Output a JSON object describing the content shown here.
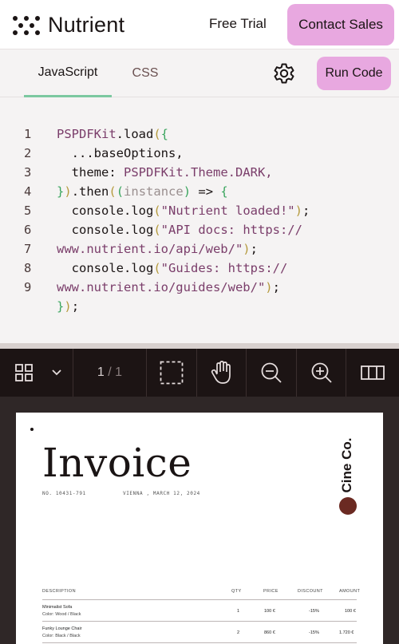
{
  "nav": {
    "brand": "Nutrient",
    "free_trial": "Free Trial",
    "contact_sales": "Contact Sales"
  },
  "editor": {
    "tabs": [
      {
        "label": "JavaScript",
        "active": true
      },
      {
        "label": "CSS",
        "active": false
      }
    ],
    "settings_icon": "gear-icon",
    "run_label": "Run Code",
    "accent": "#e8a8e0",
    "active_tab_color": "#7cc8a0",
    "lines": [
      {
        "n": "1",
        "parts": [
          [
            "PSPDFKit",
            "obj"
          ],
          [
            ".load",
            ""
          ],
          [
            "(",
            "par"
          ],
          [
            "{",
            "brk"
          ]
        ]
      },
      {
        "n": "2",
        "parts": [
          [
            "  ...baseOptions,",
            ""
          ]
        ]
      },
      {
        "n": "3",
        "parts": [
          [
            "  theme: ",
            ""
          ],
          [
            "PSPDFKit",
            "obj"
          ],
          [
            ".Theme.DARK,",
            "obj"
          ]
        ]
      },
      {
        "n": "4",
        "parts": [
          [
            "}",
            "brk"
          ],
          [
            ")",
            "par"
          ],
          [
            ".then",
            ""
          ],
          [
            "(",
            "par"
          ],
          [
            "(",
            "brk"
          ],
          [
            "instance",
            "arg"
          ],
          [
            ")",
            "brk"
          ],
          [
            " => ",
            ""
          ],
          [
            "{",
            "brk"
          ]
        ]
      },
      {
        "n": "5",
        "parts": [
          [
            "  console.log",
            ""
          ],
          [
            "(",
            "par"
          ],
          [
            "\"Nutrient loaded!\"",
            "str"
          ],
          [
            ")",
            "par"
          ],
          [
            ";",
            ""
          ]
        ]
      },
      {
        "n": "6",
        "parts": [
          [
            "  console.log",
            ""
          ],
          [
            "(",
            "par"
          ],
          [
            "\"API docs: https://",
            "str"
          ]
        ]
      },
      {
        "n": "7",
        "parts": [
          [
            "www.nutrient.io/api/web/\"",
            "str"
          ],
          [
            ")",
            "par"
          ],
          [
            ";",
            ""
          ]
        ]
      },
      {
        "n": "8",
        "parts": [
          [
            "  console.log",
            ""
          ],
          [
            "(",
            "par"
          ],
          [
            "\"Guides: https://",
            "str"
          ]
        ]
      },
      {
        "n": "9",
        "parts": [
          [
            "www.nutrient.io/guides/web/\"",
            "str"
          ],
          [
            ")",
            "par"
          ],
          [
            ";",
            ""
          ]
        ]
      },
      {
        "n": "",
        "parts": [
          [
            "}",
            "brk"
          ],
          [
            ")",
            "par"
          ],
          [
            ";",
            ""
          ]
        ]
      }
    ]
  },
  "viewer": {
    "page_current": "1",
    "page_sep": " / ",
    "page_total": "1",
    "icons": [
      "thumbnails-grid-icon",
      "chevron-down-icon",
      "marquee-select-icon",
      "pan-hand-icon",
      "zoom-out-icon",
      "zoom-in-icon",
      "layout-columns-icon"
    ]
  },
  "document": {
    "title": "Invoice",
    "number": "NO. 10431-791",
    "location_date": "VIENNA , MARCH 12, 2024",
    "brand": "Cine Co.",
    "brand_color": "#6b2a22",
    "columns": [
      "DESCRIPTION",
      "QTY",
      "PRICE",
      "DISCOUNT",
      "AMOUNT"
    ],
    "rows": [
      {
        "name": "Minimalist Sofa",
        "detail": "Color: Wood / Black",
        "qty": "1",
        "price": "100 €",
        "discount": "-15%",
        "amount": "100 €"
      },
      {
        "name": "Funky Lounge Chair",
        "detail": "Color: Black / Black",
        "qty": "2",
        "price": "860 €",
        "discount": "-15%",
        "amount": "1.720 €"
      }
    ]
  }
}
